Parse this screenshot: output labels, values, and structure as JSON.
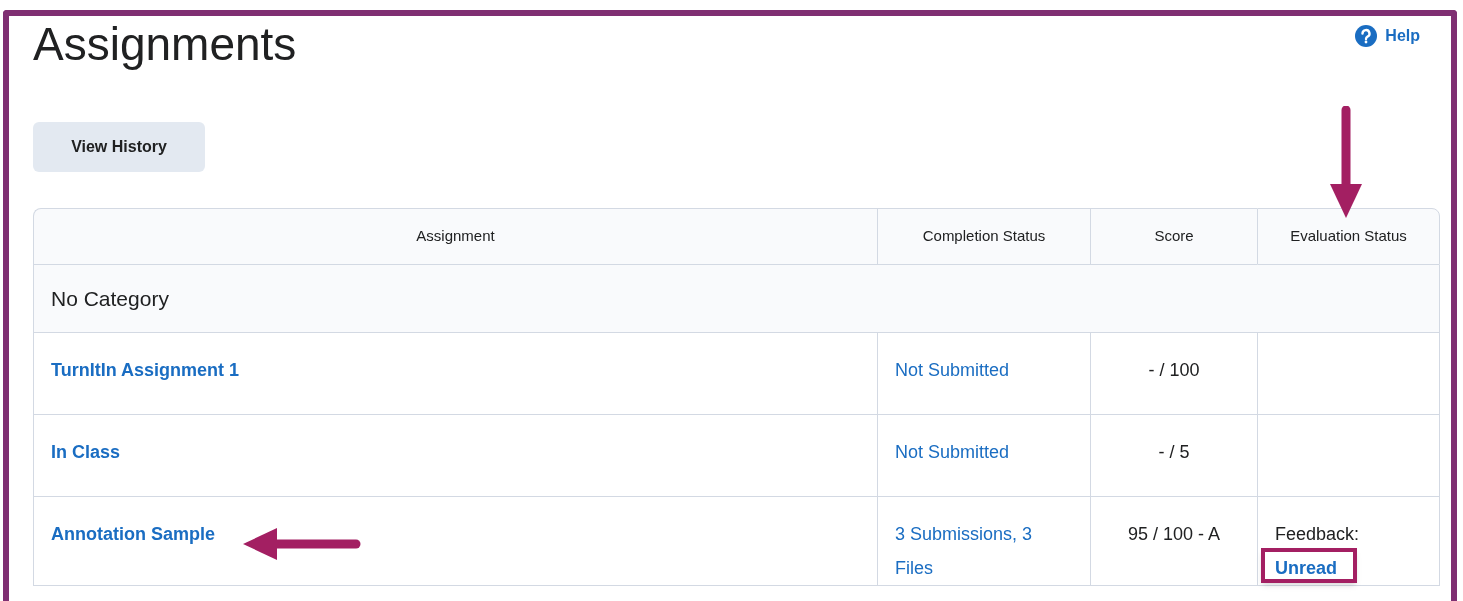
{
  "page": {
    "title": "Assignments",
    "help": "Help"
  },
  "buttons": [
    "View History"
  ],
  "table": {
    "columns": [
      "Assignment",
      "Completion Status",
      "Score",
      "Evaluation Status"
    ],
    "category": "No Category",
    "rows": [
      {
        "assignment": "TurnItIn Assignment 1",
        "completion": "Not Submitted",
        "score": "- / 100"
      },
      {
        "assignment": "In Class",
        "completion": "Not Submitted",
        "score": "- / 5"
      },
      {
        "assignment": "Annotation Sample",
        "completion": "3 Submissions, 3 Files",
        "score": "95 / 100 - A",
        "evaluation": {
          "label": "Feedback:",
          "link": "Unread"
        }
      }
    ]
  }
}
